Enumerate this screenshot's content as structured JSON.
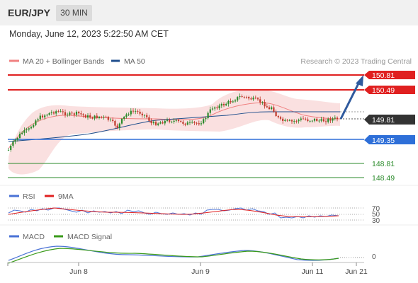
{
  "header": {
    "symbol": "EUR/JPY",
    "timeframe": "30 MIN"
  },
  "datetime": "Monday, June 12, 2023 5:22:50 AM CET",
  "main_legend": {
    "items": [
      {
        "label": "MA 20 + Bollinger Bands",
        "color": "#f08080"
      },
      {
        "label": "MA 50",
        "color": "#1f4e8c"
      }
    ],
    "credit": "Research © 2023 Trading Central"
  },
  "price_levels": [
    {
      "label": "150.81",
      "color": "#e02020",
      "style": "resistance"
    },
    {
      "label": "150.49",
      "color": "#e02020",
      "style": "resistance"
    },
    {
      "label": "149.81",
      "color": "#333333",
      "style": "current"
    },
    {
      "label": "149.35",
      "color": "#2e6fd8",
      "style": "pivot"
    },
    {
      "label": "148.81",
      "color": "#2a8a2a",
      "style": "support"
    },
    {
      "label": "148.49",
      "color": "#2a8a2a",
      "style": "support"
    }
  ],
  "rsi": {
    "legend": [
      {
        "label": "RSI",
        "color": "#4a72d6"
      },
      {
        "label": "9MA",
        "color": "#e02020"
      }
    ],
    "levels": [
      "70",
      "50",
      "30"
    ]
  },
  "macd": {
    "legend": [
      {
        "label": "MACD",
        "color": "#4a72d6"
      },
      {
        "label": "MACD Signal",
        "color": "#3a9a1a"
      }
    ],
    "zero_label": "0"
  },
  "x_axis": {
    "labels": [
      "Jun 8",
      "Jun 9",
      "Jun 11",
      "Jun 21"
    ]
  }
}
